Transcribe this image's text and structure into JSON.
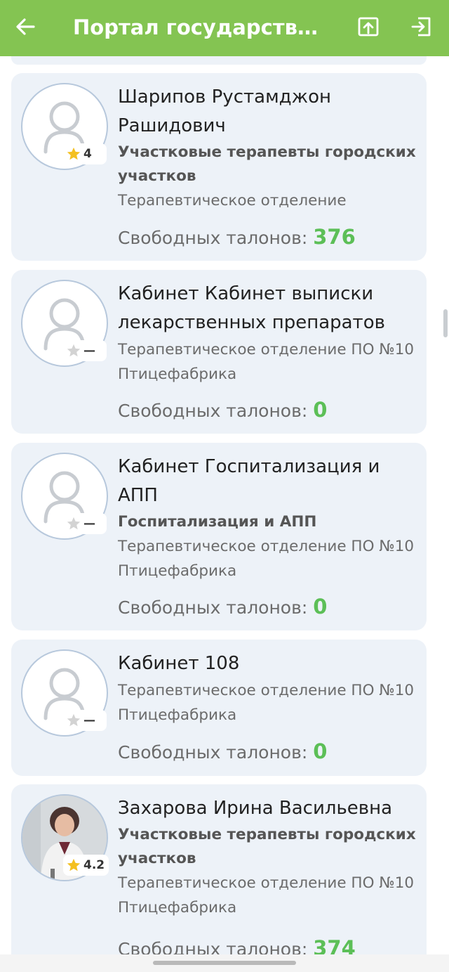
{
  "header": {
    "title": "Портал государственн…",
    "back_icon": "arrow-left-icon",
    "action1_icon": "share-upload-icon",
    "action2_icon": "logout-icon",
    "bar_color": "#84c452"
  },
  "tickets_label": "Свободных талонов: ",
  "doctors": [
    {
      "name": "Шарипов Рустамджон Рашидович",
      "specialty": "Участковые терапевты городских участков",
      "department": "Терапевтическое отделение",
      "rating": "4",
      "free_tickets": "376"
    },
    {
      "name": "Кабинет Кабинет выписки лекарственных препаратов",
      "specialty": "",
      "department": "Терапевтическое отделение ПО №10 Птицефабрика",
      "rating": "—",
      "free_tickets": "0"
    },
    {
      "name": "Кабинет Госпитализация и АПП",
      "specialty": "Госпитализация и АПП",
      "department": "Терапевтическое отделение ПО №10 Птицефабрика",
      "rating": "—",
      "free_tickets": "0"
    },
    {
      "name": "Кабинет 108",
      "specialty": "",
      "department": "Терапевтическое отделение ПО №10 Птицефабрика",
      "rating": "—",
      "free_tickets": "0"
    },
    {
      "name": "Захарова Ирина Васильевна",
      "specialty": "Участковые терапевты городских участков",
      "department": "Терапевтическое отделение ПО №10 Птицефабрика",
      "rating": "4.2",
      "free_tickets": "374"
    }
  ]
}
